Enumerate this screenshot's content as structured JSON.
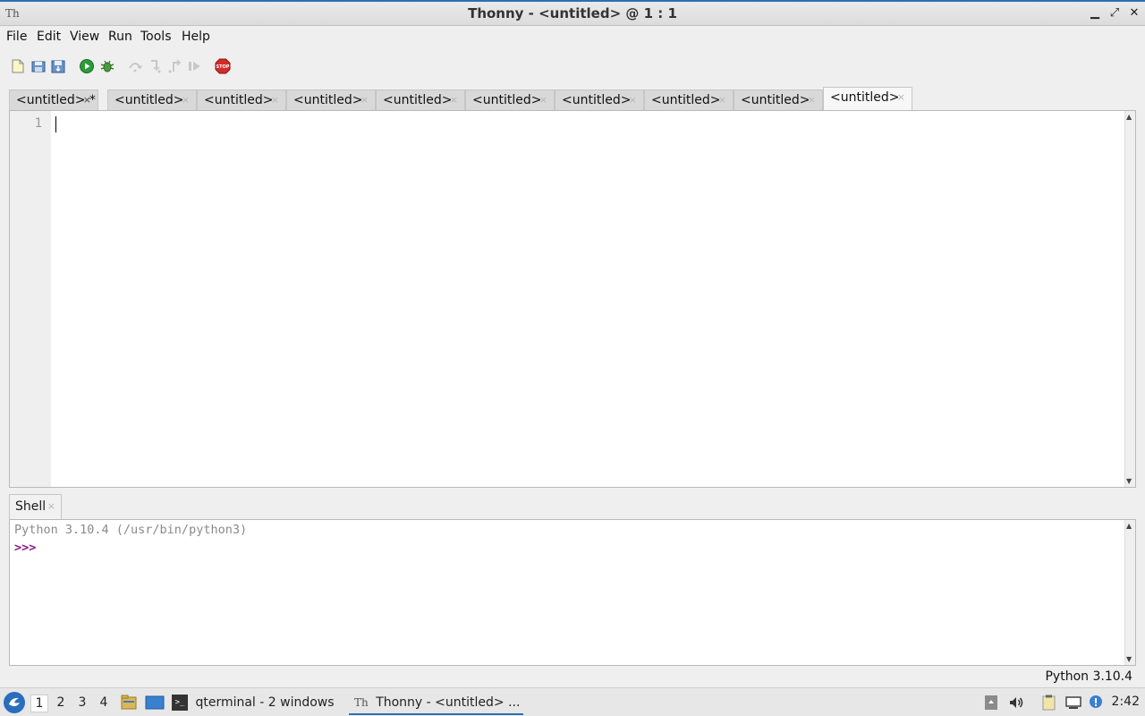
{
  "window": {
    "title": "Thonny  -  <untitled>  @  1 : 1",
    "app_icon_text": "Th",
    "minimize_glyph": "▁",
    "maximize_glyph": "⤢",
    "close_glyph": "✕"
  },
  "menu": [
    "File",
    "Edit",
    "View",
    "Run",
    "Tools",
    "Help"
  ],
  "toolbar": {
    "icons": [
      "new-file-icon",
      "open-file-icon",
      "save-file-icon",
      "run-icon",
      "debug-icon",
      "step-over-icon",
      "step-into-icon",
      "step-out-icon",
      "resume-icon",
      "stop-icon"
    ],
    "stop_label": "STOP"
  },
  "tabs": [
    {
      "label": "<untitled> *",
      "close": "×"
    },
    {
      "label": "<untitled>",
      "close": "×"
    },
    {
      "label": "<untitled>",
      "close": "×"
    },
    {
      "label": "<untitled>",
      "close": "×"
    },
    {
      "label": "<untitled>",
      "close": "×"
    },
    {
      "label": "<untitled>",
      "close": "×"
    },
    {
      "label": "<untitled>",
      "close": "×"
    },
    {
      "label": "<untitled>",
      "close": "×"
    },
    {
      "label": "<untitled>",
      "close": "×"
    },
    {
      "label": "<untitled>",
      "close": "×"
    }
  ],
  "editor": {
    "line_number": "1",
    "scroll_up": "▲",
    "scroll_down": "▼"
  },
  "shell": {
    "tab_label": "Shell",
    "tab_close": "×",
    "version_line": "Python 3.10.4 (/usr/bin/python3)",
    "prompt": ">>>"
  },
  "statusbar": {
    "python_version": "Python 3.10.4"
  },
  "taskbar": {
    "workspaces": [
      "1",
      "2",
      "3",
      "4"
    ],
    "tasks": [
      {
        "label": "qterminal - 2 windows",
        "icon_text": ">_"
      },
      {
        "label": "Thonny  -  <untitled>  ...",
        "icon_text": "Th"
      }
    ],
    "clock": "2:42"
  }
}
